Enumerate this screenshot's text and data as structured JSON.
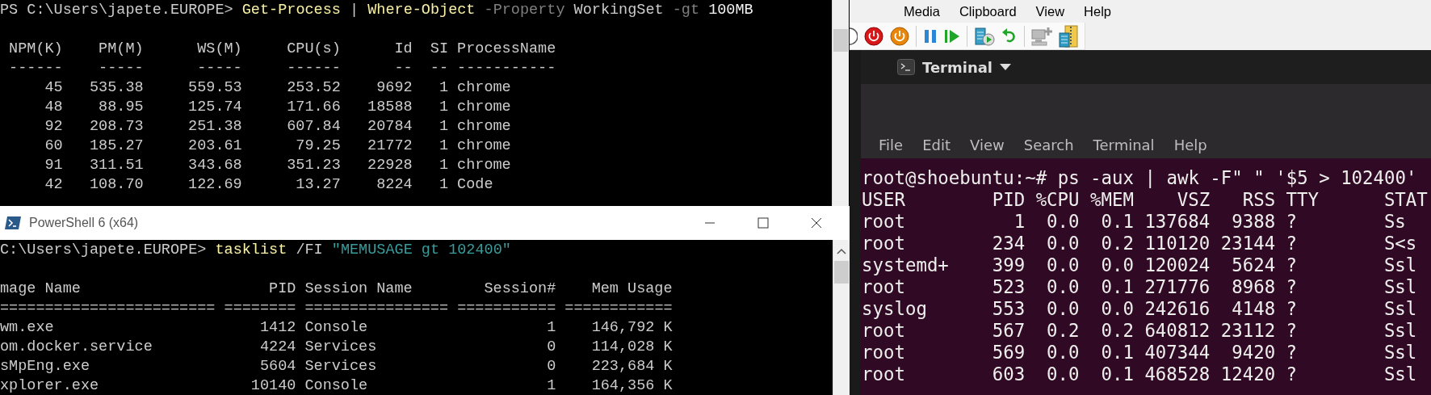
{
  "powershell_top": {
    "command": [
      {
        "kind": "prompt",
        "text": "PS C:\\Users\\japete.EUROPE>"
      },
      {
        "kind": "command",
        "text": "Get-Process"
      },
      {
        "kind": "operator",
        "text": "|"
      },
      {
        "kind": "command",
        "text": "Where-Object"
      },
      {
        "kind": "parameter",
        "text": "-Property"
      },
      {
        "kind": "argument",
        "text": "WorkingSet"
      },
      {
        "kind": "parameter",
        "text": "-gt"
      },
      {
        "kind": "number",
        "text": "100MB"
      }
    ],
    "table": {
      "columns": [
        {
          "label": "NPM(K)",
          "rule": "------"
        },
        {
          "label": "PM(M)",
          "rule": "-----"
        },
        {
          "label": "WS(M)",
          "rule": "-----"
        },
        {
          "label": "CPU(s)",
          "rule": "------"
        },
        {
          "label": "Id",
          "rule": "--"
        },
        {
          "label": "SI",
          "rule": "--"
        },
        {
          "label": "ProcessName",
          "rule": "-----------"
        }
      ],
      "rows": [
        [
          "45",
          "535.38",
          "559.53",
          "253.52",
          "9692",
          "1",
          "chrome"
        ],
        [
          "48",
          "88.95",
          "125.74",
          "171.66",
          "18588",
          "1",
          "chrome"
        ],
        [
          "92",
          "208.73",
          "251.38",
          "607.84",
          "20784",
          "1",
          "chrome"
        ],
        [
          "60",
          "185.27",
          "203.61",
          "79.25",
          "21772",
          "1",
          "chrome"
        ],
        [
          "91",
          "311.51",
          "343.68",
          "351.23",
          "22928",
          "1",
          "chrome"
        ],
        [
          "42",
          "108.70",
          "122.69",
          "13.27",
          "8224",
          "1",
          "Code"
        ]
      ]
    }
  },
  "powershell_bottom": {
    "title": "PowerShell 6 (x64)",
    "command": [
      {
        "kind": "prompt",
        "text": "C:\\Users\\japete.EUROPE>"
      },
      {
        "kind": "command",
        "text": "tasklist"
      },
      {
        "kind": "argument",
        "text": "/FI"
      },
      {
        "kind": "string",
        "text": "\"MEMUSAGE gt 102400\""
      }
    ],
    "table": {
      "columns": [
        {
          "label": "mage Name",
          "rule": "========================"
        },
        {
          "label": "PID",
          "rule": "========"
        },
        {
          "label": "Session Name",
          "rule": "================"
        },
        {
          "label": "Session#",
          "rule": "==========="
        },
        {
          "label": "Mem Usage",
          "rule": "============"
        }
      ],
      "rows": [
        [
          "wm.exe",
          "1412",
          "Console",
          "1",
          "146,792 K"
        ],
        [
          "om.docker.service",
          "4224",
          "Services",
          "0",
          "114,028 K"
        ],
        [
          "sMpEng.exe",
          "5604",
          "Services",
          "0",
          "223,684 K"
        ],
        [
          "xplorer.exe",
          "10140",
          "Console",
          "1",
          "164,356 K"
        ]
      ]
    }
  },
  "vm_window": {
    "menu": [
      "Media",
      "Clipboard",
      "View",
      "Help"
    ],
    "terminal": {
      "title": "Terminal",
      "menu": [
        "File",
        "Edit",
        "View",
        "Search",
        "Terminal",
        "Help"
      ],
      "command": "root@shoebuntu:~# ps -aux | awk -F\" \" '$5 > 102400'",
      "table": {
        "columns": [
          {
            "label": "USER"
          },
          {
            "label": "PID"
          },
          {
            "label": "%CPU"
          },
          {
            "label": "%MEM"
          },
          {
            "label": "VSZ"
          },
          {
            "label": "RSS"
          },
          {
            "label": "TTY"
          },
          {
            "label": "STAT"
          }
        ],
        "rows": [
          [
            "root",
            "1",
            "0.0",
            "0.1",
            "137684",
            "9388",
            "?",
            "Ss"
          ],
          [
            "root",
            "234",
            "0.0",
            "0.2",
            "110120",
            "23144",
            "?",
            "S<s"
          ],
          [
            "systemd+",
            "399",
            "0.0",
            "0.0",
            "120024",
            "5624",
            "?",
            "Ssl"
          ],
          [
            "root",
            "523",
            "0.0",
            "0.1",
            "271776",
            "8968",
            "?",
            "Ssl"
          ],
          [
            "syslog",
            "553",
            "0.0",
            "0.0",
            "242616",
            "4148",
            "?",
            "Ssl"
          ],
          [
            "root",
            "567",
            "0.2",
            "0.2",
            "640812",
            "23112",
            "?",
            "Ssl"
          ],
          [
            "root",
            "569",
            "0.0",
            "0.1",
            "407344",
            "9420",
            "?",
            "Ssl"
          ],
          [
            "root",
            "603",
            "0.0",
            "0.1",
            "468528",
            "12420",
            "?",
            "Ssl"
          ]
        ]
      }
    }
  }
}
